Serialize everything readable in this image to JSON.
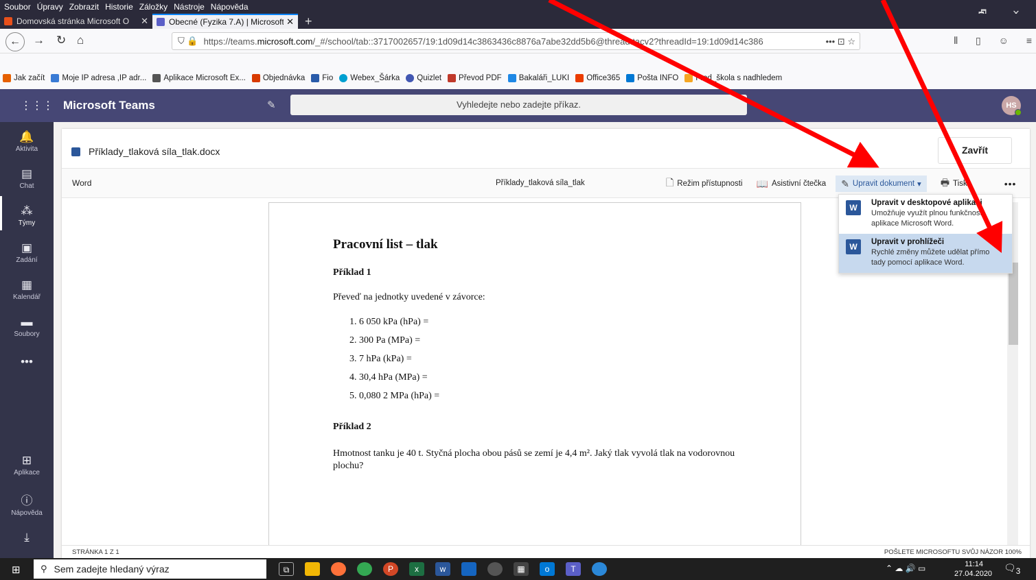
{
  "browser": {
    "menu": [
      "Soubor",
      "Úpravy",
      "Zobrazit",
      "Historie",
      "Záložky",
      "Nástroje",
      "Nápověda"
    ],
    "window_controls": [
      "—",
      "🗗",
      "✕"
    ],
    "tabs": [
      {
        "label": "Domovská stránka Microsoft O",
        "close": "✕",
        "color": "#e8501b"
      },
      {
        "label": "Obecné (Fyzika 7.A) | Microsoft",
        "close": "✕",
        "color": "#5b5fc7"
      }
    ],
    "new_tab": "+",
    "url_prefix": "https://teams.",
    "url_domain": "microsoft.com",
    "url_rest": "/_#/school/tab::3717002657/19:1d09d14c3863436c8876a7abe32dd5b6@thread.tacv2?threadId=19:1d09d14c386",
    "url_actions": "••• ⊡ ☆",
    "bookmarks": [
      {
        "label": "Jak začít",
        "color": "#e66000"
      },
      {
        "label": "Moje IP adresa ,IP adr...",
        "color": "#3a7bd5"
      },
      {
        "label": "Aplikace Microsoft Ex...",
        "color": "#555555"
      },
      {
        "label": "Objednávka",
        "color": "#d83b01"
      },
      {
        "label": "Fio",
        "color": "#2a5caa"
      },
      {
        "label": "Webex_Šárka",
        "color": "#00a0d1"
      },
      {
        "label": "Quizlet",
        "color": "#4257b2"
      },
      {
        "label": "Převod PDF",
        "color": "#c0392b"
      },
      {
        "label": "Bakaláři_LUKI",
        "color": "#1e88e5"
      },
      {
        "label": "Office365",
        "color": "#eb3c00"
      },
      {
        "label": "Pošta INFO",
        "color": "#0078d4"
      },
      {
        "label": "Fred_škola s nadhledem",
        "color": "#f5a623"
      }
    ]
  },
  "teams": {
    "title": "Microsoft Teams",
    "search_placeholder": "Vyhledejte nebo zadejte příkaz.",
    "avatar": "HS",
    "rail": [
      {
        "label": "Aktivita",
        "icon": "🔔"
      },
      {
        "label": "Chat",
        "icon": "▤"
      },
      {
        "label": "Týmy",
        "icon": "⁂"
      },
      {
        "label": "Zadání",
        "icon": "▣"
      },
      {
        "label": "Kalendář",
        "icon": "▦"
      },
      {
        "label": "Soubory",
        "icon": "▬"
      },
      {
        "label": "",
        "icon": "•••"
      },
      {
        "label": "Aplikace",
        "icon": "⊞"
      },
      {
        "label": "Nápověda",
        "icon": "?"
      },
      {
        "label": "",
        "icon": "⤓"
      }
    ]
  },
  "doc": {
    "filename": "Příklady_tlaková síla_tlak.docx",
    "close": "Zavřít",
    "app": "Word",
    "file_label": "Příklady_tlaková síla_tlak",
    "toolbar": {
      "access": "Režim přístupnosti",
      "reader": "Asistivní čtečka",
      "edit": "Upravit dokument",
      "print": "Tisk",
      "more": "•••"
    },
    "dropdown": [
      {
        "title": "Upravit v desktopové aplikaci",
        "line1": "Umožňuje využít plnou funkčnost",
        "line2": "aplikace Microsoft Word."
      },
      {
        "title": "Upravit v prohlížeči",
        "line1": "Rychlé změny můžete udělat přímo",
        "line2": "tady pomocí aplikace Word."
      }
    ],
    "page": {
      "heading": "Pracovní list – tlak",
      "ex1": "Příklad 1",
      "instruction": "Převeď na jednotky uvedené v závorce:",
      "items": [
        "1.  6 050 kPa (hPa) =",
        "2.  300 Pa (MPa) =",
        "3.  7 hPa (kPa) =",
        "4.  30,4 hPa (MPa) =",
        "5.  0,080 2 MPa (hPa) ="
      ],
      "ex2": "Příklad 2",
      "p2": "Hmotnost tanku je 40 t. Styčná plocha obou pásů se zemí je 4,4 m². Jaký tlak vyvolá tlak na vodorovnou plochu?"
    },
    "status_left": "STRÁNKA 1 Z 1",
    "status_right": "POŠLETE MICROSOFTU SVŮJ NÁZOR   100%"
  },
  "taskbar": {
    "search": "Sem zadejte hledaný výraz",
    "time": "11:14",
    "date": "27.04.2020",
    "notifications": "3",
    "apps": [
      {
        "name": "task-view",
        "color": "#1f1f1f"
      },
      {
        "name": "explorer",
        "color": "#f2b705"
      },
      {
        "name": "firefox",
        "color": "#ff7139"
      },
      {
        "name": "chrome",
        "color": "#34a853"
      },
      {
        "name": "powerpoint",
        "color": "#d24726"
      },
      {
        "name": "excel",
        "color": "#1d6f42"
      },
      {
        "name": "word",
        "color": "#2b579a"
      },
      {
        "name": "smart",
        "color": "#1565c0"
      },
      {
        "name": "recorder",
        "color": "#555555"
      },
      {
        "name": "calculator",
        "color": "#444444"
      },
      {
        "name": "outlook",
        "color": "#0078d4"
      },
      {
        "name": "teams",
        "color": "#5b5fc7"
      },
      {
        "name": "app-circle",
        "color": "#2b88d8"
      }
    ]
  },
  "annotations": {
    "arrow_color": "#ff0000"
  }
}
